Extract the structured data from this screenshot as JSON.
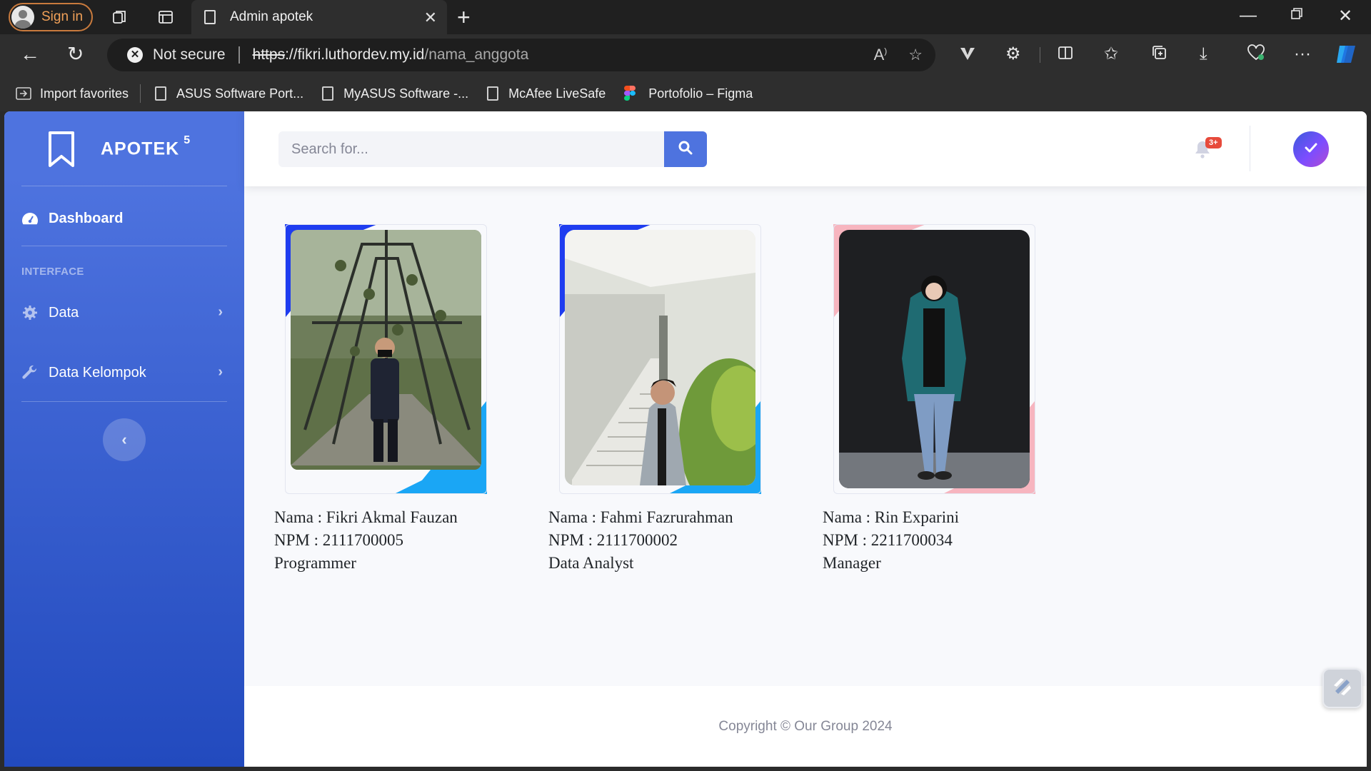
{
  "browser": {
    "signin_label": "Sign in",
    "tab_title": "Admin apotek",
    "security_label": "Not secure",
    "url_protocol": "https",
    "url_host": "://fikri.luthordev.my.id",
    "url_path": "/nama_anggota",
    "bookmarks": [
      {
        "label": "Import favorites",
        "icon": "import-icon"
      },
      {
        "label": "ASUS Software Port...",
        "icon": "page-icon"
      },
      {
        "label": "MyASUS Software -...",
        "icon": "page-icon"
      },
      {
        "label": "McAfee LiveSafe",
        "icon": "page-icon"
      },
      {
        "label": "Portofolio – Figma",
        "icon": "figma-icon"
      }
    ]
  },
  "sidebar": {
    "brand": "APOTEK",
    "brand_sup": "5",
    "dashboard_label": "Dashboard",
    "heading": "INTERFACE",
    "items": [
      {
        "label": "Data",
        "icon": "gear-icon"
      },
      {
        "label": "Data Kelompok",
        "icon": "wrench-icon"
      }
    ]
  },
  "topbar": {
    "search_placeholder": "Search for...",
    "notification_badge": "3+"
  },
  "members": [
    {
      "nama": "Nama : Fikri Akmal Fauzan",
      "npm": "NPM : 2111700005",
      "role": "Programmer",
      "accent": "#1f3df0",
      "accent2": "#1aa6f5"
    },
    {
      "nama": "Nama : Fahmi Fazrurahman",
      "npm": "NPM : 2111700002",
      "role": "Data Analyst",
      "accent": "#1f3df0",
      "accent2": "#1aa6f5"
    },
    {
      "nama": "Nama : Rin Exparini",
      "npm": "NPM : 2211700034",
      "role": "Manager",
      "accent": "#f7b5bf",
      "accent2": "#f7b5bf"
    }
  ],
  "footer": {
    "copyright": "Copyright © Our Group 2024"
  },
  "colors": {
    "primary": "#4e73df",
    "sidebar_bottom": "#224abe",
    "badge": "#e74a3b"
  }
}
